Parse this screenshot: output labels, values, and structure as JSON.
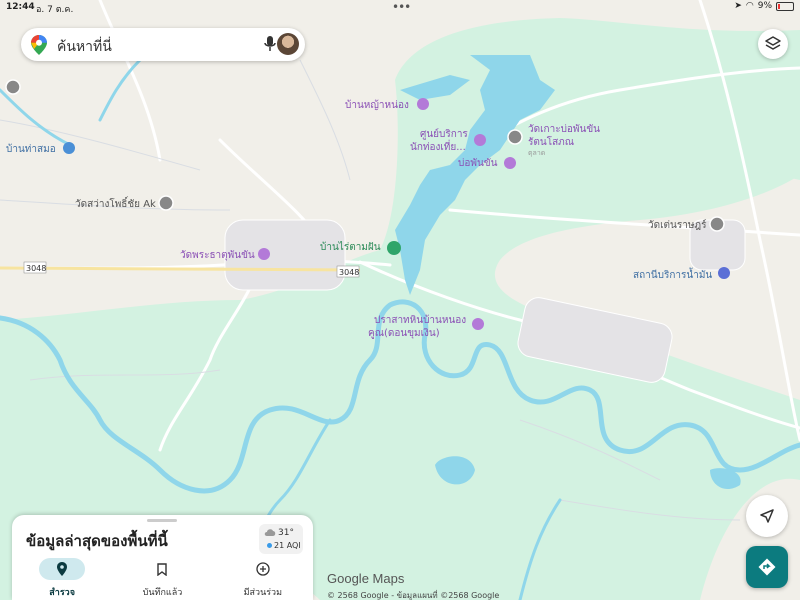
{
  "status_bar": {
    "time": "12:44",
    "date": "อ. 7 ต.ค.",
    "battery": "9%"
  },
  "search": {
    "placeholder": "ค้นหาที่นี่"
  },
  "map": {
    "places": [
      {
        "name": "บ้านหญ้าหน่อง",
        "kind": "landmark-icon"
      },
      {
        "name": "ศูนย์บริการ",
        "kind": "info-icon"
      },
      {
        "name": "นักท่องเที่ย...",
        "kind": "text"
      },
      {
        "name": "วัดเกาะบ่อพันขัน",
        "kind": "temple-icon"
      },
      {
        "name": "รัตนโสภณ",
        "kind": "text"
      },
      {
        "name": "ตุลาด",
        "kind": "text"
      },
      {
        "name": "บ่อพันขัน",
        "kind": "monument-icon"
      },
      {
        "name": "บ้านท่าสมอ",
        "kind": "school-icon"
      },
      {
        "name": "วัดสว่างโพธิ์ชัย Ak",
        "kind": "temple-icon"
      },
      {
        "name": "วัดพระธาตุพันขัน",
        "kind": "temple-icon"
      },
      {
        "name": "บ้านไร่ตามฝัน",
        "kind": "park-icon"
      },
      {
        "name": "3048",
        "kind": "road-shield"
      },
      {
        "name": "3048",
        "kind": "road-shield"
      },
      {
        "name": "วัดเต่นราษฎร์",
        "kind": "temple-icon"
      },
      {
        "name": "สถานีบริการน้ำมัน",
        "kind": "gas-icon"
      },
      {
        "name": "ปราสาทหินบ้านหนอง",
        "kind": "monument-icon"
      },
      {
        "name": "คูณ(ดอนขุมเงิน)",
        "kind": "text"
      }
    ],
    "colors": {
      "land": "#f1efe9",
      "green": "#d3f2e1",
      "water": "#8fd6ea",
      "road": "#ffffff",
      "label_purple": "#8a4fb5",
      "label_blue": "#3f6fa3"
    }
  },
  "sheet": {
    "title": "ข้อมูลล่าสุดของพื้นที่นี้",
    "weather_temp": "31°",
    "weather_aqi": "21 AQI",
    "tabs": [
      {
        "label": "สำรวจ",
        "icon": "location-pin-icon",
        "active": true
      },
      {
        "label": "บันทึกแล้ว",
        "icon": "bookmark-icon",
        "active": false
      },
      {
        "label": "มีส่วนร่วม",
        "icon": "add-circle-icon",
        "active": false
      }
    ]
  },
  "footer": {
    "logo": "Google Maps",
    "copyright": "© 2568 Google - ข้อมูลแผนที่ ©2568 Google"
  }
}
